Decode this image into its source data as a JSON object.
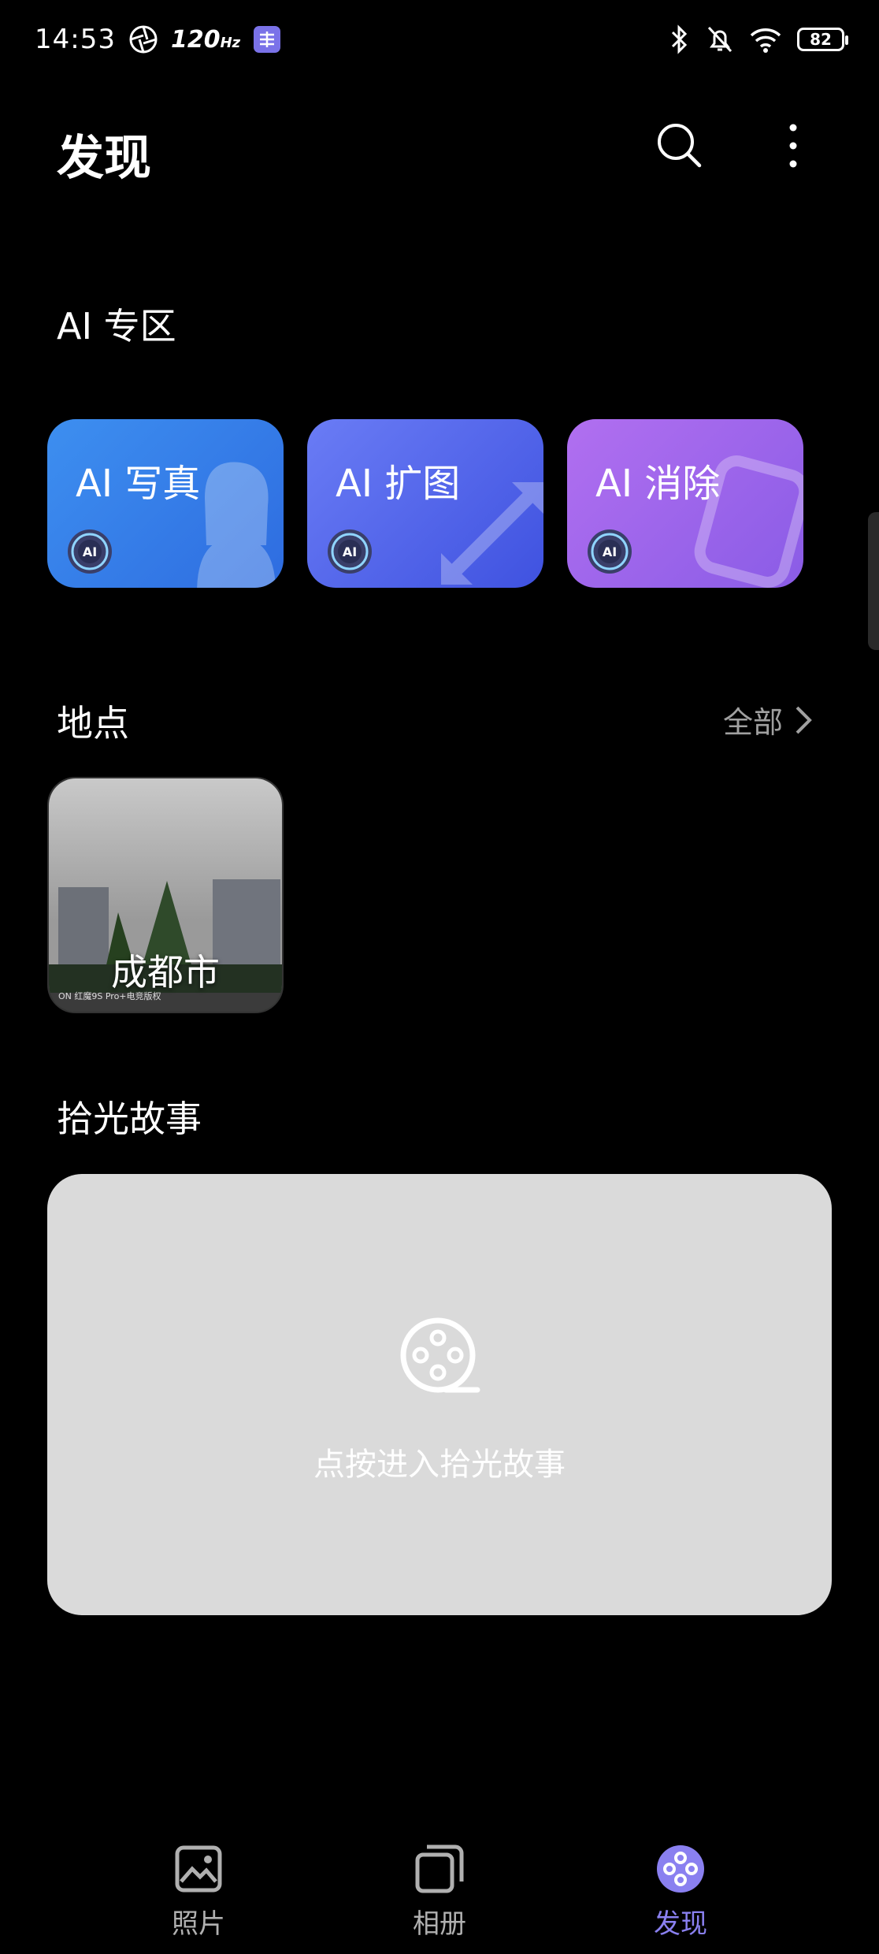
{
  "status_bar": {
    "time": "14:53",
    "refresh_rate": "120",
    "refresh_unit": "Hz",
    "battery": "82"
  },
  "header": {
    "title": "发现",
    "search_icon": "search-icon",
    "more_icon": "more-vertical-icon"
  },
  "ai_section": {
    "title": "AI 专区",
    "cards": [
      {
        "label": "AI 写真",
        "badge": "AI",
        "color": "#3d8ff0"
      },
      {
        "label": "AI 扩图",
        "badge": "AI",
        "color": "#5566ea"
      },
      {
        "label": "AI 消除",
        "badge": "AI",
        "color": "#a066ee"
      }
    ]
  },
  "places_section": {
    "title": "地点",
    "see_all": "全部",
    "items": [
      {
        "name": "成都市",
        "caption": "ON 红魔9S Pro+电竞版权"
      }
    ]
  },
  "story_section": {
    "title": "拾光故事",
    "action": "点按进入拾光故事"
  },
  "tabbar": {
    "items": [
      {
        "label": "照片",
        "icon": "photo-icon",
        "active": false
      },
      {
        "label": "相册",
        "icon": "album-icon",
        "active": false
      },
      {
        "label": "发现",
        "icon": "discover-icon",
        "active": true
      }
    ],
    "active_color": "#8a80f0",
    "inactive_color": "#b0b0b0"
  }
}
